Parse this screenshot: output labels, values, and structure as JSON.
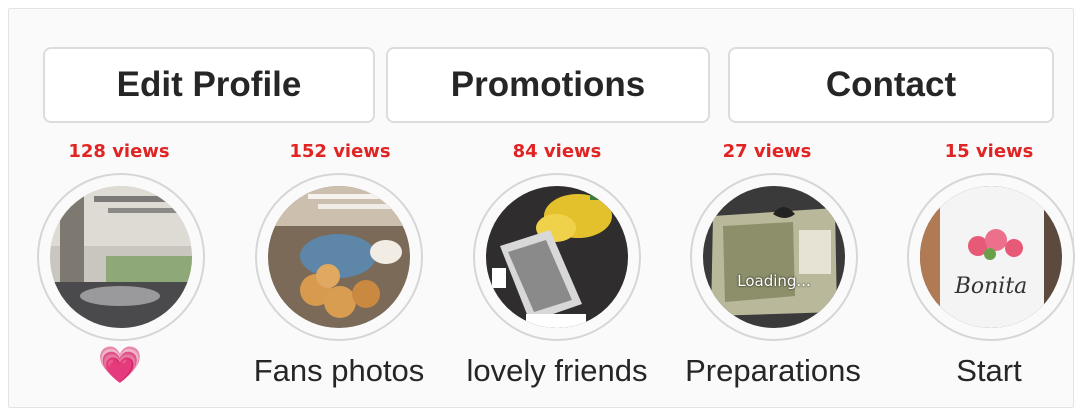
{
  "actions": {
    "edit_profile": "Edit Profile",
    "promotions": "Promotions",
    "contact": "Contact"
  },
  "highlights": [
    {
      "views": "128 views",
      "title": "💗"
    },
    {
      "views": "152 views",
      "title": "Fans photos"
    },
    {
      "views": "84 views",
      "title": "lovely friends"
    },
    {
      "views": "27 views",
      "title": "Preparations",
      "overlay": "Loading..."
    },
    {
      "views": "15 views",
      "title": "Start",
      "mug_text": "Bonita"
    }
  ],
  "colors": {
    "views": "#e02424",
    "text": "#262626",
    "border": "#dcdcdc"
  }
}
